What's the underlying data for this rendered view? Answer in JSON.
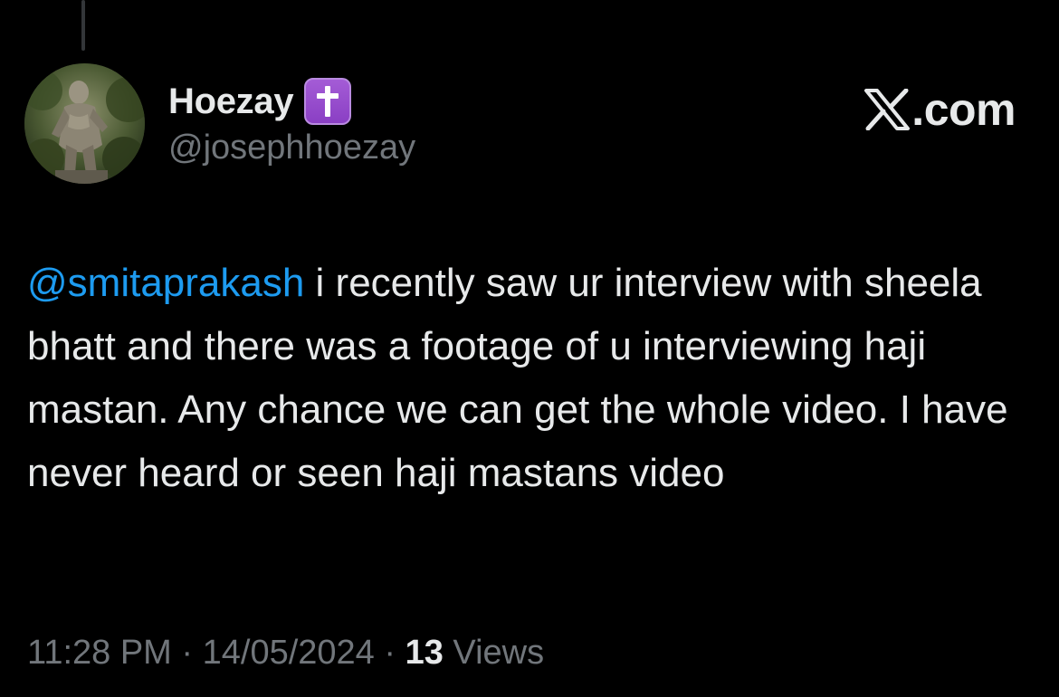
{
  "tweet": {
    "author": {
      "display_name": "Hoezay",
      "handle": "@josephhoezay",
      "badge_icon": "latin-cross-icon",
      "avatar_icon": "statue-avatar"
    },
    "brand": {
      "logo_icon": "x-logo-icon",
      "domain": ".com"
    },
    "text": {
      "mention": "@smitaprakash",
      "body": " i recently saw ur interview with sheela bhatt and there was a footage of u interviewing haji mastan. Any chance we can get the whole video. I have never heard or seen haji mastans video"
    },
    "meta": {
      "time": "11:28 PM",
      "separator_1": " · ",
      "date": "14/05/2024",
      "separator_2": " · ",
      "views_count": "13",
      "views_label": " Views"
    }
  },
  "colors": {
    "background": "#000000",
    "text_primary": "#e7e9ea",
    "text_secondary": "#71767b",
    "mention": "#1d9bf0",
    "badge": "#9b4fd0"
  }
}
